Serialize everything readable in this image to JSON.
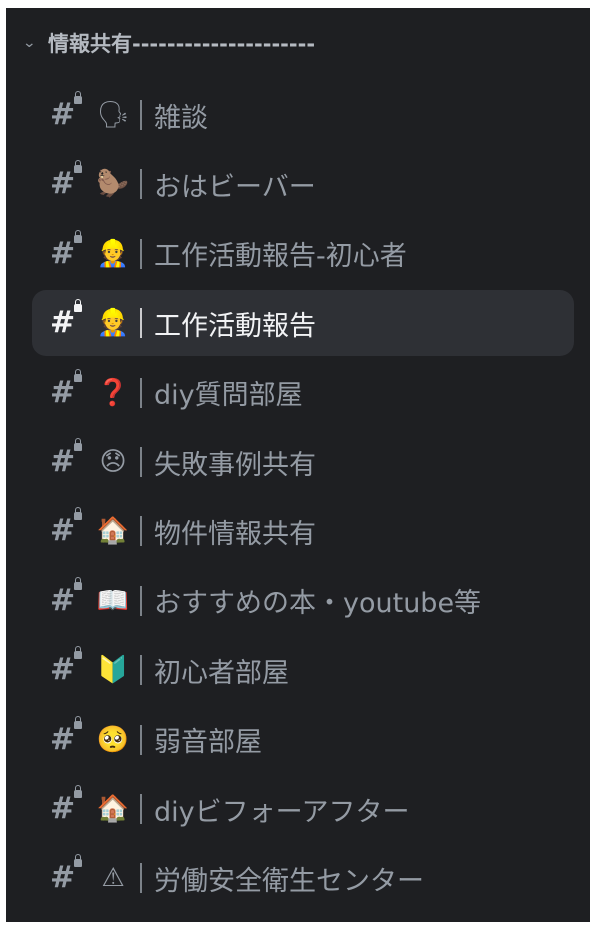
{
  "category": {
    "label": "情報共有---------------------",
    "chevron": "chevron-down-icon"
  },
  "channels": [
    {
      "emoji": "🗣",
      "emoji_name": "speaking-head-icon",
      "name": "雑談",
      "active": false
    },
    {
      "emoji": "🦫",
      "emoji_name": "beaver-icon",
      "name": "おはビーバー",
      "active": false
    },
    {
      "emoji": "👷",
      "emoji_name": "construction-worker-icon",
      "name": "工作活動報告-初心者",
      "active": false
    },
    {
      "emoji": "👷",
      "emoji_name": "construction-worker-icon",
      "name": "工作活動報告",
      "active": true
    },
    {
      "emoji": "❓",
      "emoji_name": "question-mark-icon",
      "name": "diy質問部屋",
      "active": false
    },
    {
      "emoji": "😞",
      "emoji_name": "disappointed-face-icon",
      "name": "失敗事例共有",
      "active": false
    },
    {
      "emoji": "🏠",
      "emoji_name": "house-icon",
      "name": "物件情報共有",
      "active": false
    },
    {
      "emoji": "📖",
      "emoji_name": "open-book-icon",
      "name": "おすすめの本・youtube等",
      "active": false
    },
    {
      "emoji": "🔰",
      "emoji_name": "beginner-mark-icon",
      "name": "初心者部屋",
      "active": false
    },
    {
      "emoji": "🥺",
      "emoji_name": "pleading-face-icon",
      "name": "弱音部屋",
      "active": false
    },
    {
      "emoji": "🏠",
      "emoji_name": "house-icon",
      "name": "diyビフォーアフター",
      "active": false
    },
    {
      "emoji": "⚠",
      "emoji_name": "warning-icon",
      "name": "労働安全衛生センター",
      "active": false
    }
  ],
  "colors": {
    "background": "#1e1f22",
    "active_row": "#2e3035",
    "text_muted": "#949ba4",
    "text_active": "#f2f3f5"
  }
}
